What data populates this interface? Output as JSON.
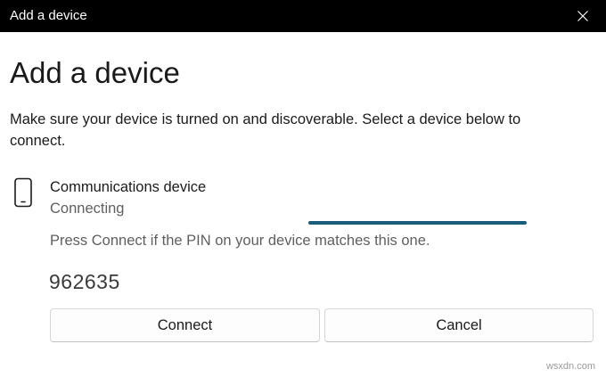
{
  "window": {
    "title": "Add a device",
    "close_icon": "close-icon"
  },
  "main": {
    "heading": "Add a device",
    "description": "Make sure your device is turned on and discoverable. Select a device below to connect."
  },
  "device": {
    "icon": "phone-icon",
    "name": "Communications device",
    "status": "Connecting"
  },
  "pairing": {
    "prompt": "Press Connect if the PIN on your device matches this one.",
    "pin": "962635"
  },
  "buttons": {
    "connect_label": "Connect",
    "cancel_label": "Cancel"
  },
  "progress": {
    "indeterminate": true,
    "color": "#1b5c7a"
  },
  "watermark": {
    "text": "wsxdn.com"
  }
}
